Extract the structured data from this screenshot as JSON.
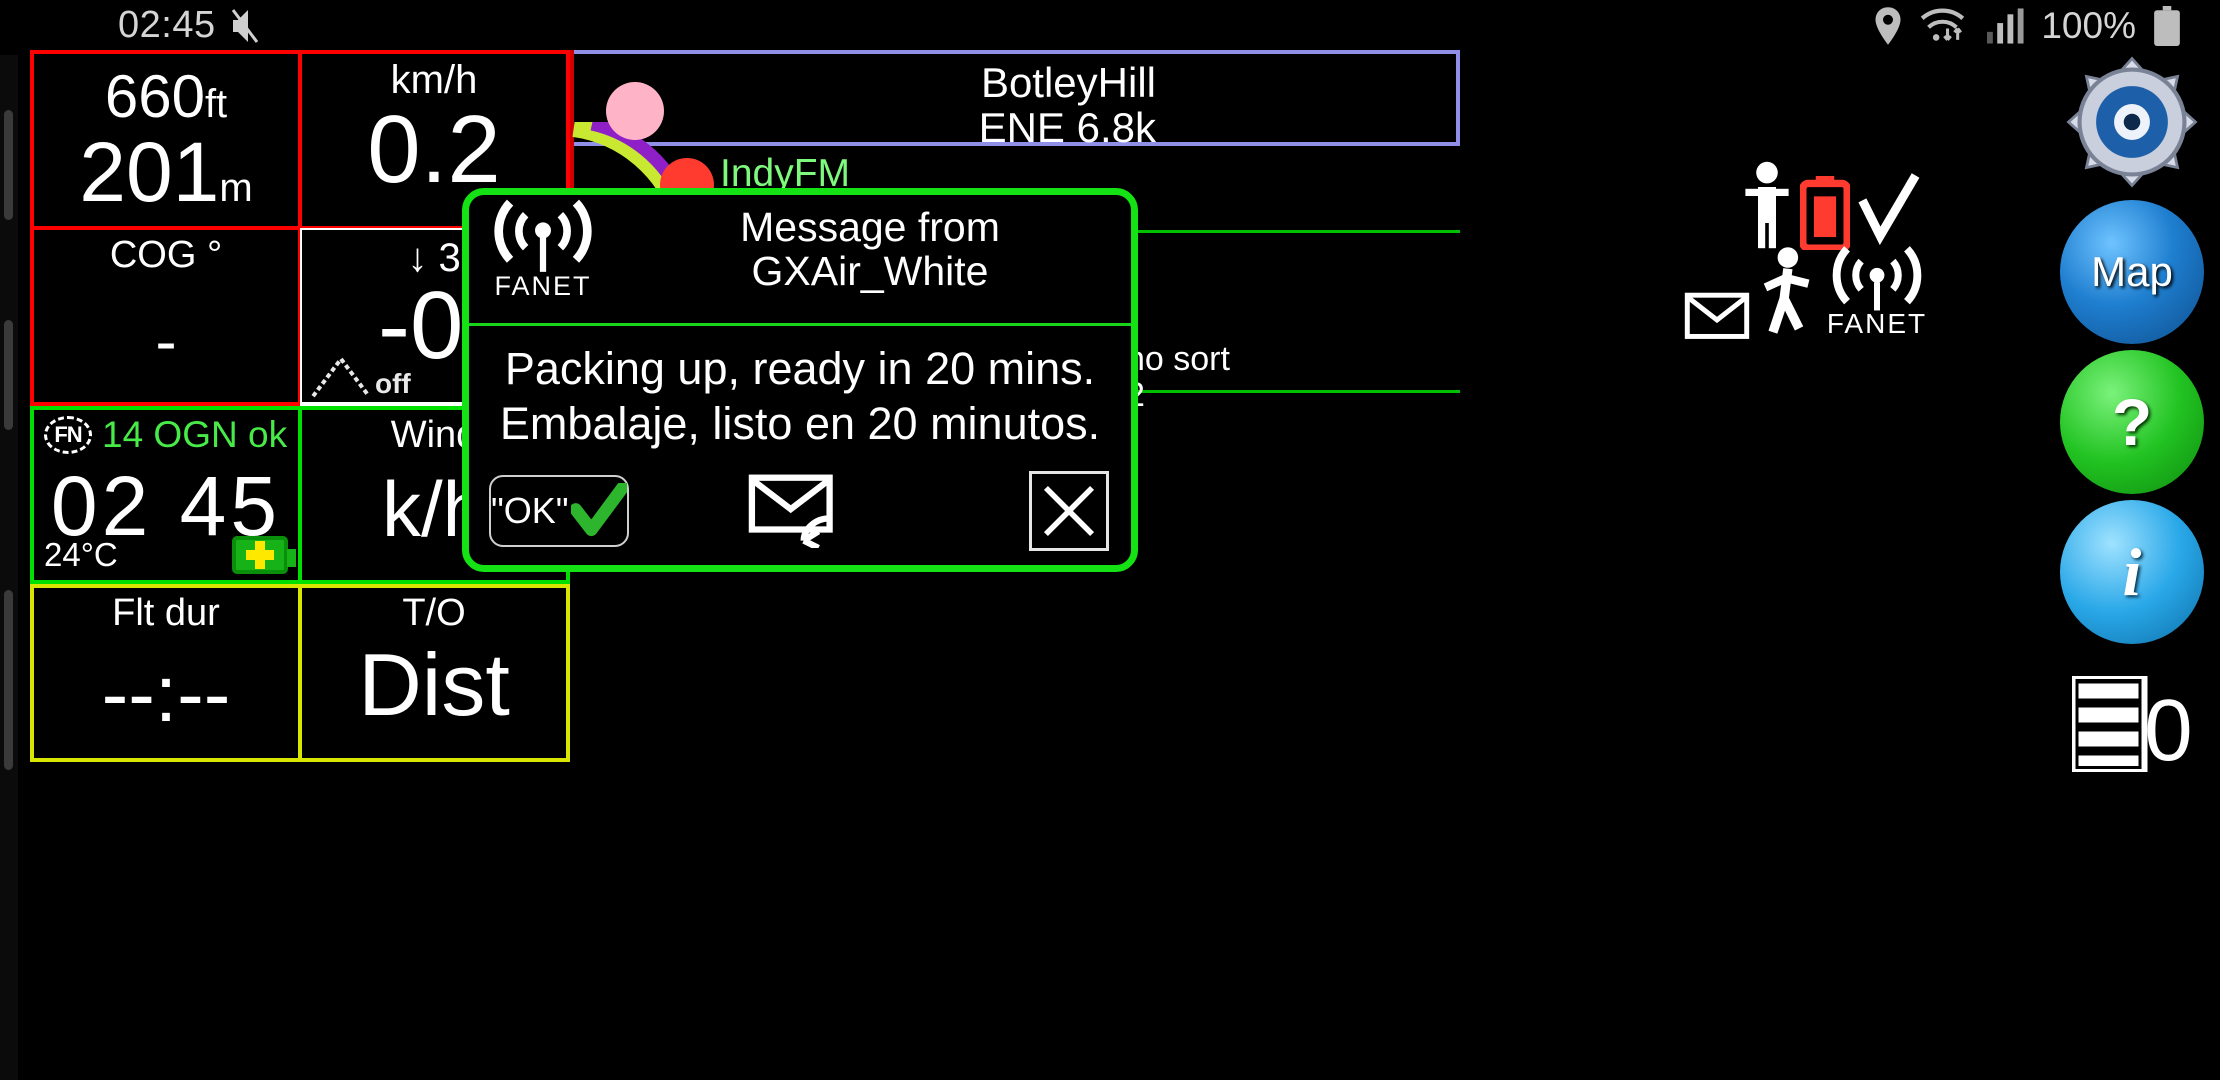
{
  "statusbar": {
    "time": "02:45",
    "battery_percent": "100%",
    "icons": [
      "mute-icon",
      "location-pin-icon",
      "wifi-icon",
      "signal-bars-icon",
      "battery-icon"
    ]
  },
  "gauges": {
    "altitude": {
      "feet": "660",
      "feet_unit": "ft",
      "meters": "201",
      "meters_unit": "m",
      "border_color": "#ff0000"
    },
    "speed": {
      "unit": "km/h",
      "value": "0.2",
      "border_color": "#ff0000"
    },
    "cog": {
      "label": "COG °",
      "value": "-",
      "border_color": "#ff0000"
    },
    "vario": {
      "arrow": "↓",
      "arrow_value": "3",
      "value": "-0.",
      "mode": "off",
      "border_color": "#ffffff"
    },
    "ogn": {
      "badge": "FN",
      "status": "14 OGN ok",
      "value": "02 45",
      "temperature": "24°C",
      "border_color": "#00e000"
    },
    "wind": {
      "label": "Wind",
      "unit": "k/h",
      "border_color": "#00e000"
    },
    "flight_duration": {
      "label": "Flt dur",
      "value": "--:--",
      "border_color": "#d8e600"
    },
    "takeoff": {
      "label": "T/O",
      "value": "Dist",
      "border_color": "#d8e600"
    }
  },
  "map": {
    "selected_pilot": {
      "name": "BotleyHill",
      "info": "ENE  6.8k",
      "border_color": "#8f8fe8"
    },
    "pilots": [
      {
        "label": "IndyFM",
        "color": "#ff3b30"
      },
      {
        "label": "",
        "color": "#ffb3c6"
      }
    ],
    "sort_label": "no sort",
    "count_label": "2",
    "line_color": "#00c000"
  },
  "toolbar": {
    "gear_label": "",
    "map_label": "Map",
    "help_label": "?",
    "info_label": "i",
    "pages_label": "0"
  },
  "dialog": {
    "logo_text": "FANET",
    "title_line1": "Message from",
    "title_line2": "GXAir_White",
    "body_line1": "Packing up, ready in 20 mins.",
    "body_line2": "Embalaje, listo en 20 minutos.",
    "ok_label": "\"OK\"",
    "reply_label": "reply",
    "close_label": "close",
    "border_color": "#15e215"
  }
}
